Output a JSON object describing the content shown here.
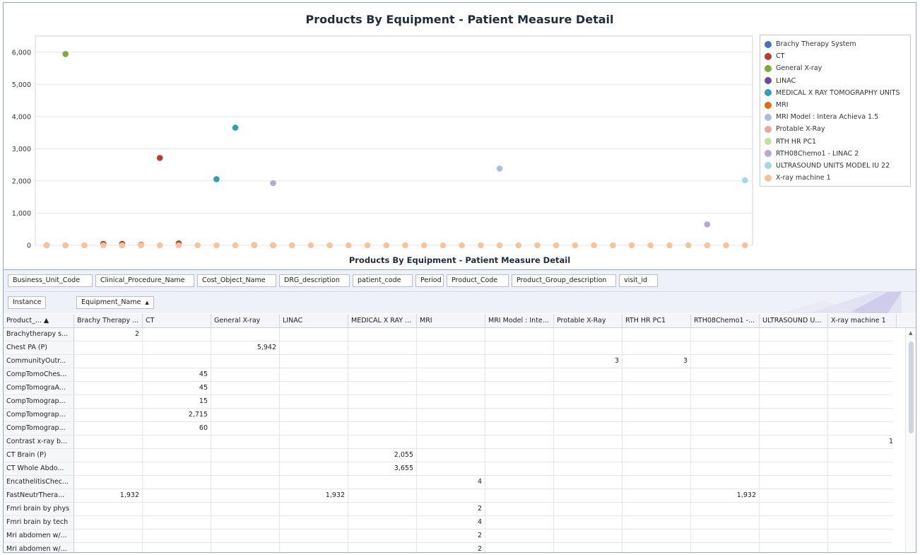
{
  "chart": {
    "title": "Products By Equipment - Patient Measure Detail",
    "caption": "Products By Equipment - Patient Measure Detail"
  },
  "chart_data": {
    "type": "scatter",
    "title": "Products By Equipment - Patient Measure Detail",
    "ylim": [
      0,
      6500
    ],
    "y_ticks": [
      "0",
      "1,000",
      "2,000",
      "3,000",
      "4,000",
      "5,000",
      "6,000"
    ],
    "y_tick_values": [
      0,
      1000,
      2000,
      3000,
      4000,
      5000,
      6000
    ],
    "x_count": 38,
    "grid": "horizontal",
    "legend_position": "right",
    "series": [
      {
        "name": "Brachy Therapy System",
        "color": "#4472c4",
        "points": [
          [
            0,
            2
          ],
          [
            1,
            0
          ]
        ]
      },
      {
        "name": "CT",
        "color": "#c0392b",
        "points": [
          [
            3,
            45
          ],
          [
            4,
            45
          ],
          [
            5,
            15
          ],
          [
            6,
            2715
          ],
          [
            7,
            60
          ]
        ]
      },
      {
        "name": "General X-ray",
        "color": "#7cab3c",
        "points": [
          [
            1,
            5942
          ]
        ]
      },
      {
        "name": "LINAC",
        "color": "#6b4c9a",
        "points": [
          [
            12,
            0
          ]
        ]
      },
      {
        "name": "MEDICAL X RAY TOMOGRAPHY UNITS",
        "color": "#2ea0b6",
        "points": [
          [
            9,
            2055
          ],
          [
            10,
            3655
          ]
        ]
      },
      {
        "name": "MRI",
        "color": "#e46c0a",
        "points": [
          [
            11,
            4
          ]
        ]
      },
      {
        "name": "MRI Model : Intera Achieva 1.5",
        "color": "#a9bedf",
        "points": [
          [
            24,
            2385
          ]
        ]
      },
      {
        "name": "Protable X-Ray",
        "color": "#e6a9a3",
        "points": [
          [
            2,
            3
          ]
        ]
      },
      {
        "name": "RTH HR PC1",
        "color": "#c6dea0",
        "points": [
          [
            13,
            3
          ]
        ]
      },
      {
        "name": "RTH08Chemo1 - LINAC 2",
        "color": "#b8a9d3",
        "points": [
          [
            12,
            1932
          ],
          [
            35,
            650
          ]
        ]
      },
      {
        "name": "ULTRASOUND UNITS MODEL IU 22",
        "color": "#a7d7e3",
        "points": [
          [
            37,
            2020
          ]
        ]
      },
      {
        "name": "X-ray machine 1",
        "color": "#f5c49a",
        "points": [
          [
            0,
            0
          ],
          [
            1,
            0
          ],
          [
            2,
            0
          ],
          [
            3,
            0
          ],
          [
            4,
            0
          ],
          [
            5,
            0
          ],
          [
            6,
            0
          ],
          [
            7,
            0
          ],
          [
            8,
            0
          ],
          [
            9,
            0
          ],
          [
            10,
            0
          ],
          [
            11,
            0
          ],
          [
            12,
            0
          ],
          [
            13,
            0
          ],
          [
            14,
            0
          ],
          [
            15,
            0
          ],
          [
            16,
            0
          ],
          [
            17,
            0
          ],
          [
            18,
            0
          ],
          [
            19,
            0
          ],
          [
            20,
            0
          ],
          [
            21,
            0
          ],
          [
            22,
            0
          ],
          [
            23,
            0
          ],
          [
            24,
            0
          ],
          [
            25,
            0
          ],
          [
            26,
            0
          ],
          [
            27,
            0
          ],
          [
            28,
            0
          ],
          [
            29,
            0
          ],
          [
            30,
            0
          ],
          [
            31,
            0
          ],
          [
            32,
            0
          ],
          [
            33,
            0
          ],
          [
            34,
            0
          ],
          [
            35,
            0
          ],
          [
            36,
            0
          ],
          [
            37,
            0
          ]
        ]
      }
    ]
  },
  "filter_fields": [
    "Business_Unit_Code",
    "Clinical_Procedure_Name",
    "Cost_Object_Name",
    "DRG_description",
    "patient_code",
    "Period",
    "Product_Code",
    "Product_Group_description",
    "visit_id"
  ],
  "data_field": "Instance",
  "column_field": {
    "label": "Equipment_Name",
    "sort": "▲"
  },
  "row_header": {
    "label": "Product_...",
    "sort": "▲"
  },
  "columns": [
    "Brachy Therapy ...",
    "CT",
    "General X-ray",
    "LINAC",
    "MEDICAL X RAY ...",
    "MRI",
    "MRI Model : Inte...",
    "Protable X-Ray",
    "RTH HR PC1",
    "RTH08Chemo1 -...",
    "ULTRASOUND U...",
    "X-ray machine 1"
  ],
  "rows": [
    {
      "label": "Brachytherapy s...",
      "cells": [
        "2",
        "",
        "",
        "",
        "",
        "",
        "",
        "",
        "",
        "",
        "",
        ""
      ]
    },
    {
      "label": "Chest PA (P)",
      "cells": [
        "",
        "",
        "5,942",
        "",
        "",
        "",
        "",
        "",
        "",
        "",
        "",
        ""
      ]
    },
    {
      "label": "CommunityOutr...",
      "cells": [
        "",
        "",
        "",
        "",
        "",
        "",
        "",
        "3",
        "3",
        "",
        "",
        ""
      ]
    },
    {
      "label": "CompTomoChes...",
      "cells": [
        "",
        "45",
        "",
        "",
        "",
        "",
        "",
        "",
        "",
        "",
        "",
        ""
      ]
    },
    {
      "label": "CompTomograA...",
      "cells": [
        "",
        "45",
        "",
        "",
        "",
        "",
        "",
        "",
        "",
        "",
        "",
        ""
      ]
    },
    {
      "label": "CompTomograp...",
      "cells": [
        "",
        "15",
        "",
        "",
        "",
        "",
        "",
        "",
        "",
        "",
        "",
        ""
      ]
    },
    {
      "label": "CompTomograp...",
      "cells": [
        "",
        "2,715",
        "",
        "",
        "",
        "",
        "",
        "",
        "",
        "",
        "",
        ""
      ]
    },
    {
      "label": "CompTomograp...",
      "cells": [
        "",
        "60",
        "",
        "",
        "",
        "",
        "",
        "",
        "",
        "",
        "",
        ""
      ]
    },
    {
      "label": "Contrast x-ray b...",
      "cells": [
        "",
        "",
        "",
        "",
        "",
        "",
        "",
        "",
        "",
        "",
        "",
        "1"
      ]
    },
    {
      "label": "CT Brain  (P)",
      "cells": [
        "",
        "",
        "",
        "",
        "2,055",
        "",
        "",
        "",
        "",
        "",
        "",
        ""
      ]
    },
    {
      "label": "CT Whole Abdo...",
      "cells": [
        "",
        "",
        "",
        "",
        "3,655",
        "",
        "",
        "",
        "",
        "",
        "",
        ""
      ]
    },
    {
      "label": "EncathelitisChec...",
      "cells": [
        "",
        "",
        "",
        "",
        "",
        "4",
        "",
        "",
        "",
        "",
        "",
        ""
      ]
    },
    {
      "label": "FastNeutrThera...",
      "cells": [
        "1,932",
        "",
        "",
        "1,932",
        "",
        "",
        "",
        "",
        "",
        "1,932",
        "",
        ""
      ]
    },
    {
      "label": "Fmri brain by phys",
      "cells": [
        "",
        "",
        "",
        "",
        "",
        "2",
        "",
        "",
        "",
        "",
        "",
        ""
      ]
    },
    {
      "label": "Fmri brain by tech",
      "cells": [
        "",
        "",
        "",
        "",
        "",
        "4",
        "",
        "",
        "",
        "",
        "",
        ""
      ]
    },
    {
      "label": "Mri abdomen w/...",
      "cells": [
        "",
        "",
        "",
        "",
        "",
        "2",
        "",
        "",
        "",
        "",
        "",
        ""
      ]
    },
    {
      "label": "Mri abdomen w/...",
      "cells": [
        "",
        "",
        "",
        "",
        "",
        "2",
        "",
        "",
        "",
        "",
        "",
        ""
      ]
    }
  ]
}
